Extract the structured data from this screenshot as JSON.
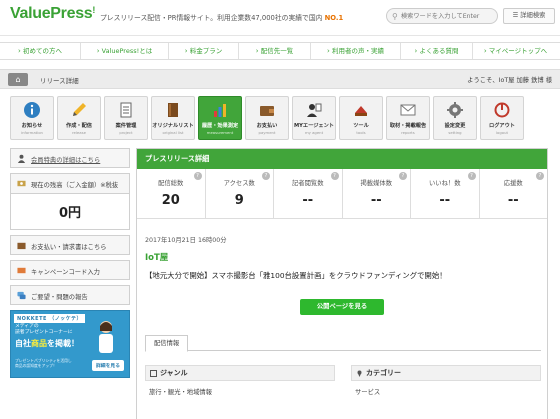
{
  "header": {
    "logo": "ValuePress",
    "logo_mark": "!",
    "tagline_prefix": "プレスリリース配信・PR情報サイト。利用企業数47,000社の実績で国内 ",
    "tagline_highlight": "NO.1",
    "search_placeholder": "検索ワードを入力してEnter",
    "advanced_search": "詳細検索"
  },
  "nav": [
    {
      "label": "初めての方へ",
      "icon": "chevron-icon"
    },
    {
      "label": "ValuePress!とは",
      "icon": "chevron-icon"
    },
    {
      "label": "料金プラン",
      "icon": "chevron-icon"
    },
    {
      "label": "配信先一覧",
      "icon": "chevron-icon"
    },
    {
      "label": "利用者の声・実績",
      "icon": "chevron-icon"
    },
    {
      "label": "よくある質問",
      "icon": "chevron-icon"
    },
    {
      "label": "マイページトップへ",
      "icon": "chevron-icon"
    }
  ],
  "breadcrumb": {
    "home_icon": "home-icon",
    "current": "リリース詳細",
    "welcome": "ようこそ、IoT屋 加藤 鉄博 様"
  },
  "tiles": [
    {
      "label": "お知らせ",
      "sub": "information",
      "icon": "info-icon"
    },
    {
      "label": "作成・配信",
      "sub": "release",
      "icon": "pencil-icon"
    },
    {
      "label": "案件管理",
      "sub": "project",
      "icon": "document-icon"
    },
    {
      "label": "オリジナルリスト",
      "sub": "original list",
      "icon": "book-icon"
    },
    {
      "label": "履歴・効果測定",
      "sub": "measurement",
      "icon": "chart-icon",
      "active": true
    },
    {
      "label": "お支払い",
      "sub": "payment",
      "icon": "wallet-icon"
    },
    {
      "label": "MYエージェント",
      "sub": "my agent",
      "icon": "agent-icon"
    },
    {
      "label": "ツール",
      "sub": "tools",
      "icon": "tools-icon"
    },
    {
      "label": "取材・掲載報告",
      "sub": "reports",
      "icon": "mail-icon"
    },
    {
      "label": "設定変更",
      "sub": "setting",
      "icon": "gear-icon"
    },
    {
      "label": "ログアウト",
      "sub": "logout",
      "icon": "logout-icon"
    }
  ],
  "sidebar": {
    "member_link": "会員特典の詳細はこちら",
    "balance_label": "現在の残高（ご入金額）※税抜",
    "balance_amount": "0円",
    "payment_link": "お支払い・請求書はこちら",
    "campaign_input": "キャンペーンコード入力",
    "feedback": "ご要望・問題の報告"
  },
  "banner": {
    "brand": "NOKKETE",
    "brand_sub": "（ノッケテ）",
    "line1": "メディアの",
    "line2": "読者プレゼントコーナーに",
    "main_prefix": "自社",
    "main_highlight": "商品",
    "main_suffix": "を掲載！",
    "small1": "プレゼントパブリシティを活用し",
    "small2": "商品の認知度をアップ！",
    "button": "詳細を見る"
  },
  "main": {
    "header": "プレスリリース詳細",
    "stats": [
      {
        "label": "配信総数",
        "value": "20"
      },
      {
        "label": "アクセス数",
        "value": "9"
      },
      {
        "label": "記者閲覧数",
        "value": "--"
      },
      {
        "label": "掲載媒体数",
        "value": "--"
      },
      {
        "label": "いいね！数",
        "value": "--"
      },
      {
        "label": "応援数",
        "value": "--"
      }
    ],
    "help_mark": "?",
    "date": "2017年10月21日 16時00分",
    "company": "IoT屋",
    "title": "【地元大分で開始】スマホ撮影台「雅100台設置計画」をクラウドファンディングで開始！",
    "public_button": "公開ページを見る",
    "tab": "配信情報",
    "genre_label": "ジャンル",
    "genre_value": "旅行・観光・地域情報",
    "category_label": "カテゴリー",
    "category_value": "サービス"
  },
  "colors": {
    "brand_green": "#3aa235",
    "accent_orange": "#e87200",
    "banner_blue": "#3399cc"
  }
}
